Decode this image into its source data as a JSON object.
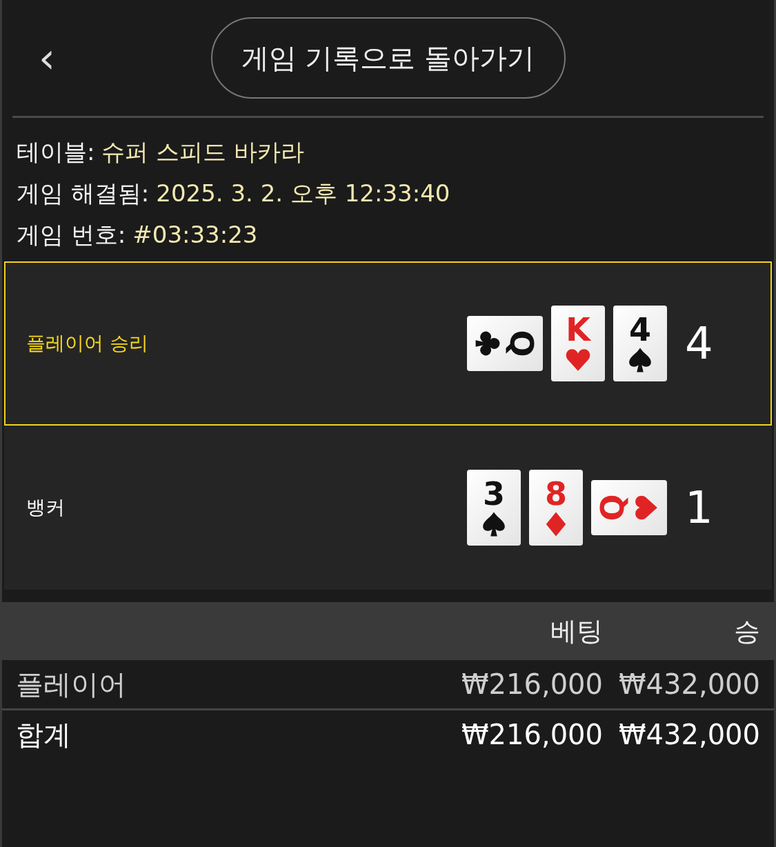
{
  "header": {
    "back_label": "‹",
    "button": "게임 기록으로 돌아가기"
  },
  "info": [
    {
      "label": "테이블:",
      "value": "슈퍼 스피드 바카라"
    },
    {
      "label": "게임 해결됨:",
      "value": "2025. 3. 2. 오후 12:33:40"
    },
    {
      "label": "게임 번호:",
      "value": "#03:33:23"
    }
  ],
  "hands": [
    {
      "label": "플레이어 승리",
      "winner": true,
      "total": "4",
      "cards": [
        {
          "rank": "Q",
          "kind": "clubs",
          "rotated": true,
          "flipped": false
        },
        {
          "rank": "K",
          "kind": "hearts",
          "rotated": false,
          "flipped": false
        },
        {
          "rank": "4",
          "kind": "spades",
          "rotated": false,
          "flipped": false
        }
      ]
    },
    {
      "label": "뱅커",
      "winner": false,
      "total": "1",
      "cards": [
        {
          "rank": "3",
          "kind": "spades",
          "rotated": false,
          "flipped": false
        },
        {
          "rank": "8",
          "kind": "diamonds",
          "rotated": false,
          "flipped": false
        },
        {
          "rank": "Q",
          "kind": "hearts",
          "rotated": true,
          "flipped": true
        }
      ]
    }
  ],
  "bets": {
    "columns": [
      "베팅",
      "승"
    ],
    "rows": [
      {
        "name": "플레이어",
        "bet": "₩216,000",
        "win": "₩432,000"
      }
    ],
    "total": {
      "name": "합계",
      "bet": "₩216,000",
      "win": "₩432,000"
    }
  }
}
